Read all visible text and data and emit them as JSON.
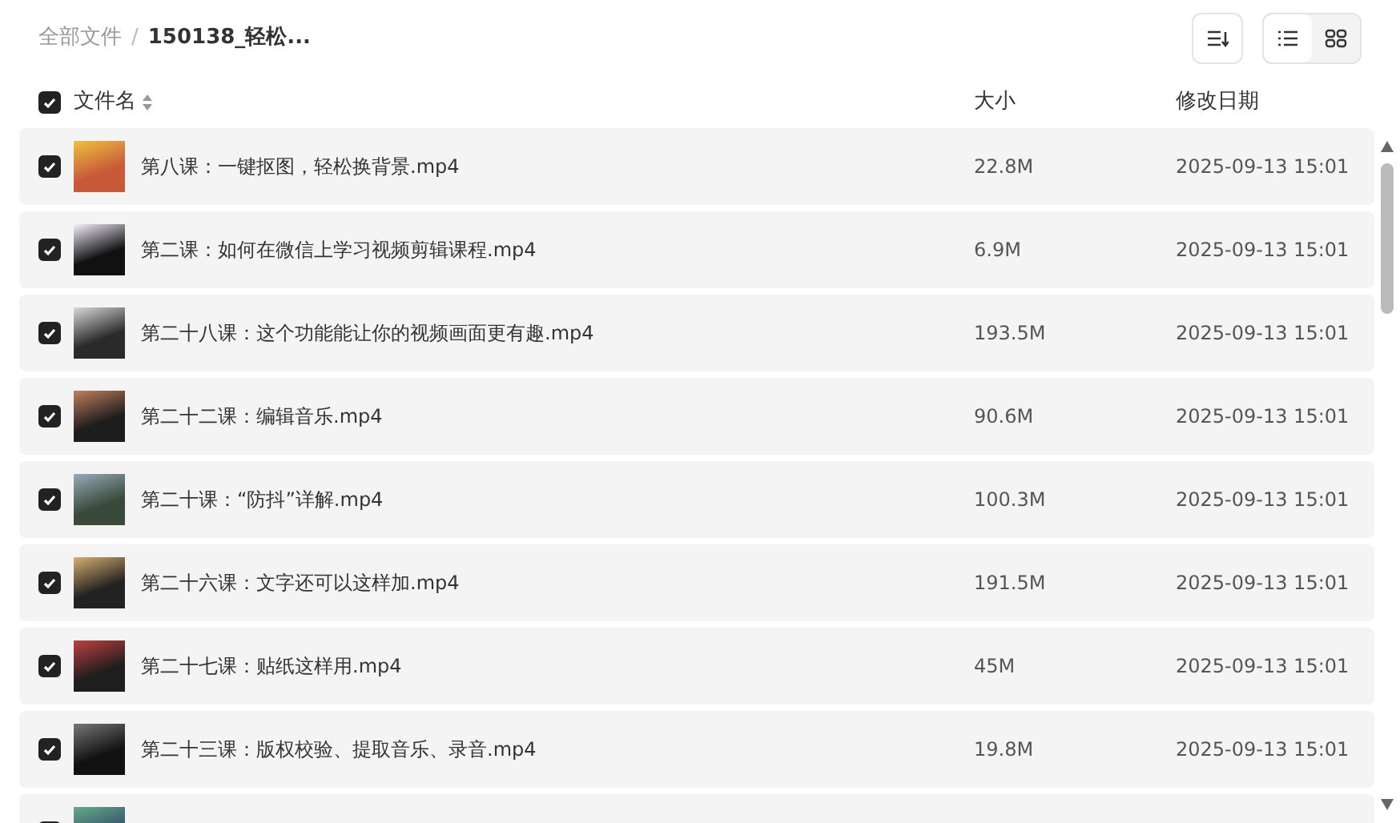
{
  "breadcrumb_separator": "/",
  "breadcrumb": [
    {
      "label": "全部文件",
      "current": false
    },
    {
      "label": "150138_轻松...",
      "current": true
    }
  ],
  "view_modes": [
    {
      "kind": "list",
      "selected": true
    },
    {
      "kind": "grid",
      "selected": false
    }
  ],
  "columns": {
    "select_all_checked": true,
    "name": "文件名",
    "size": "大小",
    "modified": "修改日期"
  },
  "rows": [
    {
      "name": "第八课：一键抠图，轻松换背景.mp4",
      "size": "22.8M",
      "modified": "2025-09-13 15:01",
      "checked": true
    },
    {
      "name": "第二课：如何在微信上学习视频剪辑课程.mp4",
      "size": "6.9M",
      "modified": "2025-09-13 15:01",
      "checked": true
    },
    {
      "name": "第二十八课：这个功能能让你的视频画面更有趣.mp4",
      "size": "193.5M",
      "modified": "2025-09-13 15:01",
      "checked": true
    },
    {
      "name": "第二十二课：编辑音乐.mp4",
      "size": "90.6M",
      "modified": "2025-09-13 15:01",
      "checked": true
    },
    {
      "name": "第二十课：“防抖”详解.mp4",
      "size": "100.3M",
      "modified": "2025-09-13 15:01",
      "checked": true
    },
    {
      "name": "第二十六课：文字还可以这样加.mp4",
      "size": "191.5M",
      "modified": "2025-09-13 15:01",
      "checked": true
    },
    {
      "name": "第二十七课：贴纸这样用.mp4",
      "size": "45M",
      "modified": "2025-09-13 15:01",
      "checked": true
    },
    {
      "name": "第二十三课：版权校验、提取音乐、录音.mp4",
      "size": "19.8M",
      "modified": "2025-09-13 15:01",
      "checked": true
    },
    {
      "checked": true
    }
  ]
}
